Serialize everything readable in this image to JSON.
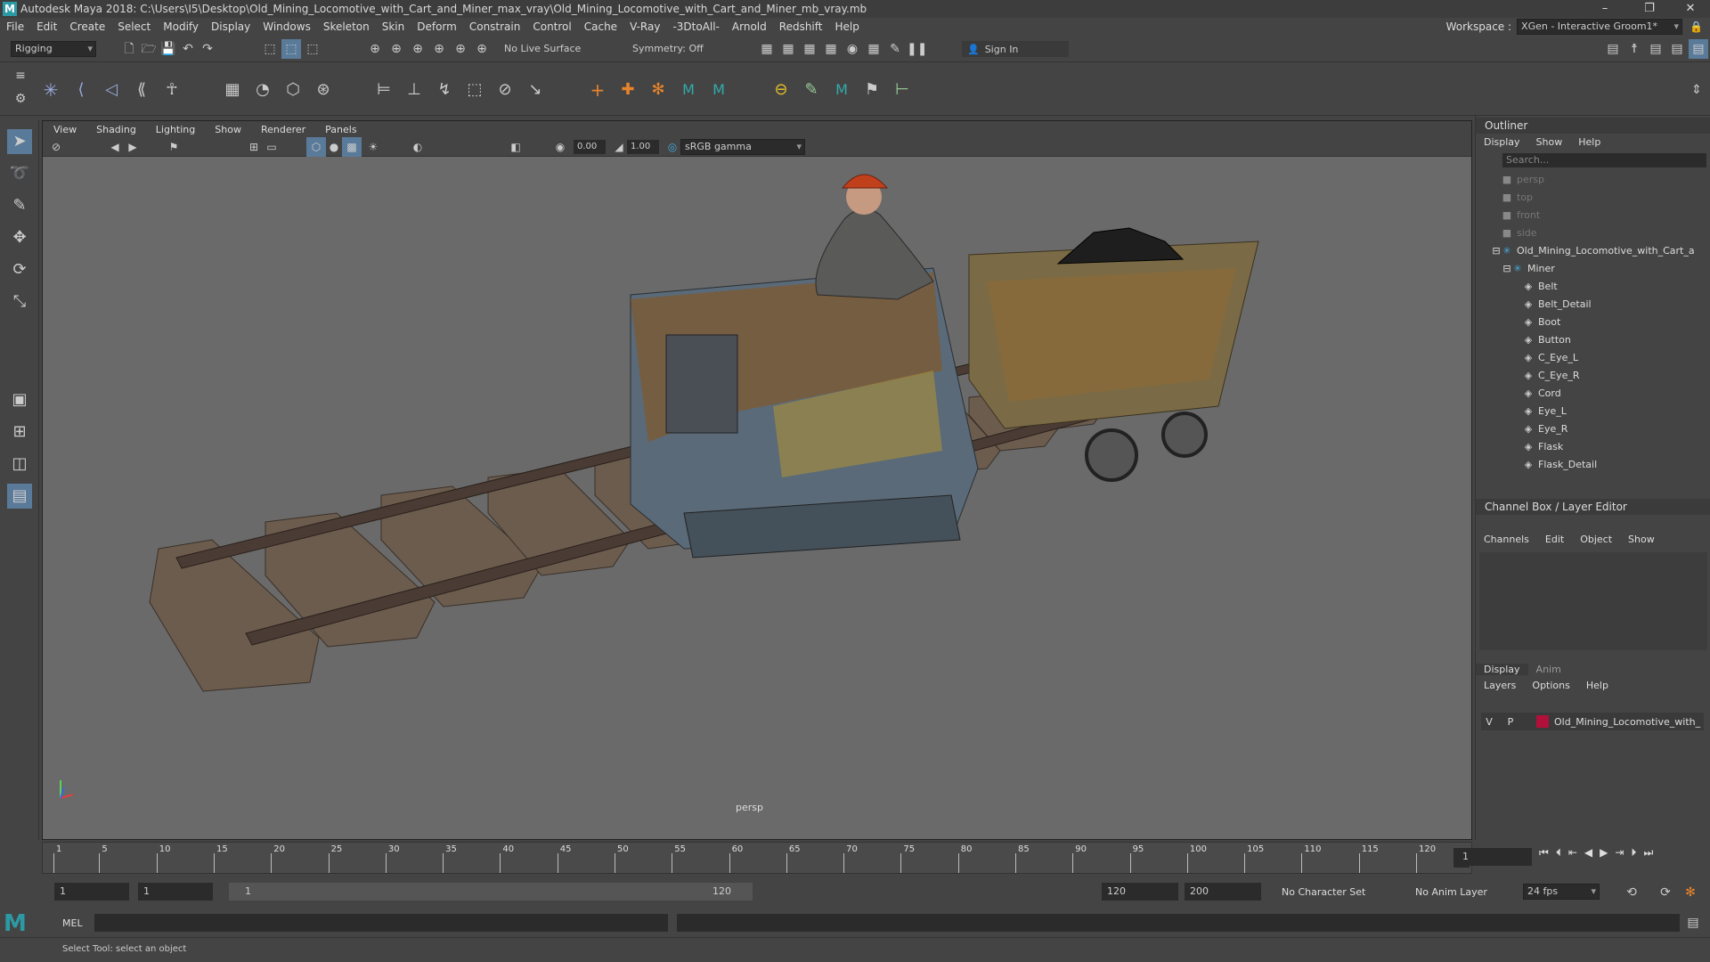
{
  "window": {
    "title": "Autodesk Maya 2018: C:\\Users\\I5\\Desktop\\Old_Mining_Locomotive_with_Cart_and_Miner_max_vray\\Old_Mining_Locomotive_with_Cart_and_Miner_mb_vray.mb",
    "minimize": "–",
    "restore": "❐",
    "close": "✕"
  },
  "menubar": {
    "items": [
      "File",
      "Edit",
      "Create",
      "Select",
      "Modify",
      "Display",
      "Windows",
      "Skeleton",
      "Skin",
      "Deform",
      "Constrain",
      "Control",
      "Cache",
      "V-Ray",
      "-3DtoAll-",
      "Arnold",
      "Redshift",
      "Help"
    ],
    "workspace_label": "Workspace :",
    "workspace_value": "XGen - Interactive Groom1*"
  },
  "statusline": {
    "mode": "Rigging",
    "live_surface": "No Live Surface",
    "symmetry": "Symmetry: Off",
    "sign_in": "Sign In"
  },
  "viewport": {
    "menus": [
      "View",
      "Shading",
      "Lighting",
      "Show",
      "Renderer",
      "Panels"
    ],
    "exposure": "0.00",
    "gamma": "1.00",
    "color_space": "sRGB gamma",
    "camera_label": "persp"
  },
  "outliner": {
    "title": "Outliner",
    "menus": [
      "Display",
      "Show",
      "Help"
    ],
    "search_placeholder": "Search...",
    "items": [
      {
        "label": "persp",
        "type": "camera",
        "depth": 0,
        "dim": true
      },
      {
        "label": "top",
        "type": "camera",
        "depth": 0,
        "dim": true
      },
      {
        "label": "front",
        "type": "camera",
        "depth": 0,
        "dim": true
      },
      {
        "label": "side",
        "type": "camera",
        "depth": 0,
        "dim": true
      },
      {
        "label": "Old_Mining_Locomotive_with_Cart_a",
        "type": "group",
        "depth": 0,
        "dim": false
      },
      {
        "label": "Miner",
        "type": "group",
        "depth": 1,
        "dim": false
      },
      {
        "label": "Belt",
        "type": "mesh",
        "depth": 2,
        "dim": false
      },
      {
        "label": "Belt_Detail",
        "type": "mesh",
        "depth": 2,
        "dim": false
      },
      {
        "label": "Boot",
        "type": "mesh",
        "depth": 2,
        "dim": false
      },
      {
        "label": "Button",
        "type": "mesh",
        "depth": 2,
        "dim": false
      },
      {
        "label": "C_Eye_L",
        "type": "mesh",
        "depth": 2,
        "dim": false
      },
      {
        "label": "C_Eye_R",
        "type": "mesh",
        "depth": 2,
        "dim": false
      },
      {
        "label": "Cord",
        "type": "mesh",
        "depth": 2,
        "dim": false
      },
      {
        "label": "Eye_L",
        "type": "mesh",
        "depth": 2,
        "dim": false
      },
      {
        "label": "Eye_R",
        "type": "mesh",
        "depth": 2,
        "dim": false
      },
      {
        "label": "Flask",
        "type": "mesh",
        "depth": 2,
        "dim": false
      },
      {
        "label": "Flask_Detail",
        "type": "mesh",
        "depth": 2,
        "dim": false
      }
    ]
  },
  "channelbox": {
    "title": "Channel Box / Layer Editor",
    "menus": [
      "Channels",
      "Edit",
      "Object",
      "Show"
    ]
  },
  "layers": {
    "tabs": [
      "Display",
      "Anim"
    ],
    "menus": [
      "Layers",
      "Options",
      "Help"
    ],
    "row": {
      "v": "V",
      "p": "P",
      "name": "Old_Mining_Locomotive_with_",
      "color": "#b0103a"
    }
  },
  "timeline": {
    "tick_labels": [
      "1",
      "5",
      "10",
      "15",
      "20",
      "25",
      "30",
      "35",
      "40",
      "45",
      "50",
      "55",
      "60",
      "65",
      "70",
      "75",
      "80",
      "85",
      "90",
      "95",
      "100",
      "105",
      "110",
      "115",
      "120"
    ],
    "current_frame": "1"
  },
  "range": {
    "start": "1",
    "playback_start": "1",
    "slider_start": "1",
    "slider_end": "120",
    "playback_end": "120",
    "end": "200",
    "character_set": "No Character Set",
    "anim_layer": "No Anim Layer",
    "fps": "24 fps"
  },
  "commandline": {
    "lang": "MEL"
  },
  "helpline": {
    "text": "Select Tool: select an object"
  }
}
